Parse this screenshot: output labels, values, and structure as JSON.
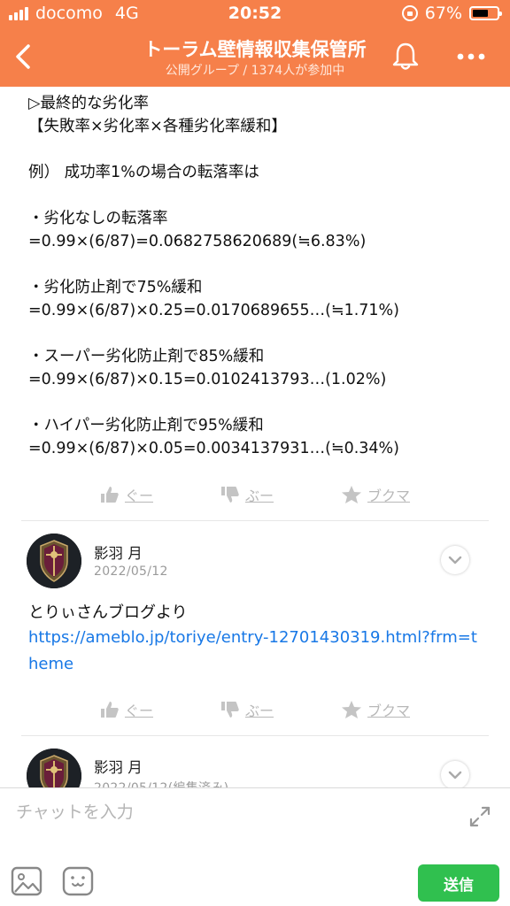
{
  "status_bar": {
    "carrier": "docomo",
    "network": "4G",
    "time": "20:52",
    "battery": "67%",
    "battery_level": 0.67,
    "signal_bars": 4
  },
  "header": {
    "title": "トーラム壁情報収集保管所",
    "subtitle": "公開グループ / 1374人が参加中",
    "back_icon": "chevron-left-icon",
    "bell_icon": "bell-icon",
    "more_icon": "more-dots-icon",
    "bg_color": "#f6804a"
  },
  "post": {
    "text": "▷最終的な劣化率\n【失敗率×劣化率×各種劣化率緩和】\n\n例） 成功率1%の場合の転落率は\n\n・劣化なしの転落率\n=0.99×(6/87)=0.0682758620689(≒6.83%)\n\n・劣化防止剤で75%緩和\n=0.99×(6/87)×0.25=0.0170689655…(≒1.71%)\n\n・スーパー劣化防止剤で85%緩和\n=0.99×(6/87)×0.15=0.0102413793…(1.02%)\n\n・ハイパー劣化防止剤で95%緩和\n=0.99×(6/87)×0.05=0.0034137931…(≒0.34%)"
  },
  "reactions": {
    "like_label": "ぐー",
    "dislike_label": "ぶー",
    "bookmark_label": "ブクマ"
  },
  "comments": [
    {
      "user_name": "影羽 月",
      "date": "2022/05/12",
      "text": "とりぃさんブログより",
      "link": "https://ameblo.jp/toriye/entry-12701430319.html?frm=theme"
    },
    {
      "user_name": "影羽 月",
      "date": "2022/05/12(編集済み)"
    }
  ],
  "input_bar": {
    "placeholder": "チャットを入力",
    "send_label": "送信",
    "send_color": "#30c04f"
  }
}
